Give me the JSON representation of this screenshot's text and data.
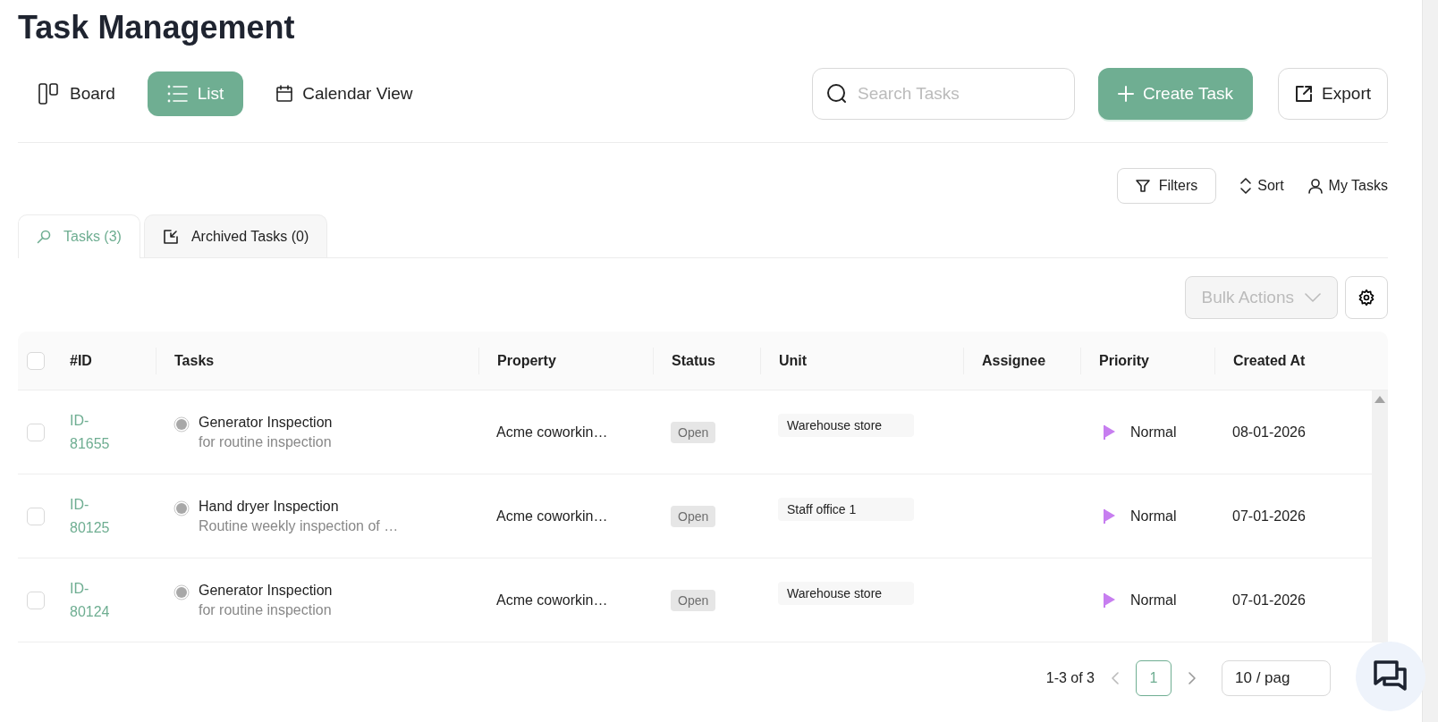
{
  "page": {
    "title": "Task Management"
  },
  "views": [
    {
      "kind": "board",
      "label": "Board",
      "selected": false
    },
    {
      "kind": "list",
      "label": "List",
      "selected": true
    },
    {
      "kind": "calendar",
      "label": "Calendar View",
      "selected": false
    }
  ],
  "search": {
    "placeholder": "Search Tasks"
  },
  "actions": {
    "create": "Create Task",
    "export": "Export"
  },
  "toolbar": {
    "filters": "Filters",
    "sort": "Sort",
    "my_tasks": "My Tasks"
  },
  "tabs": [
    {
      "kind": "tasks",
      "label": "Tasks (3)",
      "selected": true
    },
    {
      "kind": "archived",
      "label": "Archived Tasks (0)",
      "selected": false
    }
  ],
  "bulk_actions": {
    "label": "Bulk Actions",
    "disabled": true
  },
  "table": {
    "select_all_checked": false,
    "columns": [
      "#ID",
      "Tasks",
      "Property",
      "Status",
      "Unit",
      "Assignee",
      "Priority",
      "Created At"
    ],
    "rows": [
      {
        "checked": false,
        "id_prefix": "ID-",
        "id_number": "81655",
        "task": "Generator Inspection",
        "description": "for routine inspection",
        "property": "Acme coworkin…",
        "status": "Open",
        "unit": "Warehouse store",
        "priority": "Normal",
        "created_at": "08-01-2026"
      },
      {
        "checked": false,
        "id_prefix": "ID-",
        "id_number": "80125",
        "task": "Hand dryer Inspection",
        "description": "Routine weekly inspection of …",
        "property": "Acme coworkin…",
        "status": "Open",
        "unit": "Staff office 1",
        "priority": "Normal",
        "created_at": "07-01-2026"
      },
      {
        "checked": false,
        "id_prefix": "ID-",
        "id_number": "80124",
        "task": "Generator Inspection",
        "description": "for routine inspection",
        "property": "Acme coworkin…",
        "status": "Open",
        "unit": "Warehouse store",
        "priority": "Normal",
        "created_at": "07-01-2026"
      }
    ]
  },
  "pagination": {
    "range": "1-3 of 3",
    "pages": [
      {
        "label": "1",
        "selected": true
      }
    ],
    "page_size": "10 / pag"
  }
}
